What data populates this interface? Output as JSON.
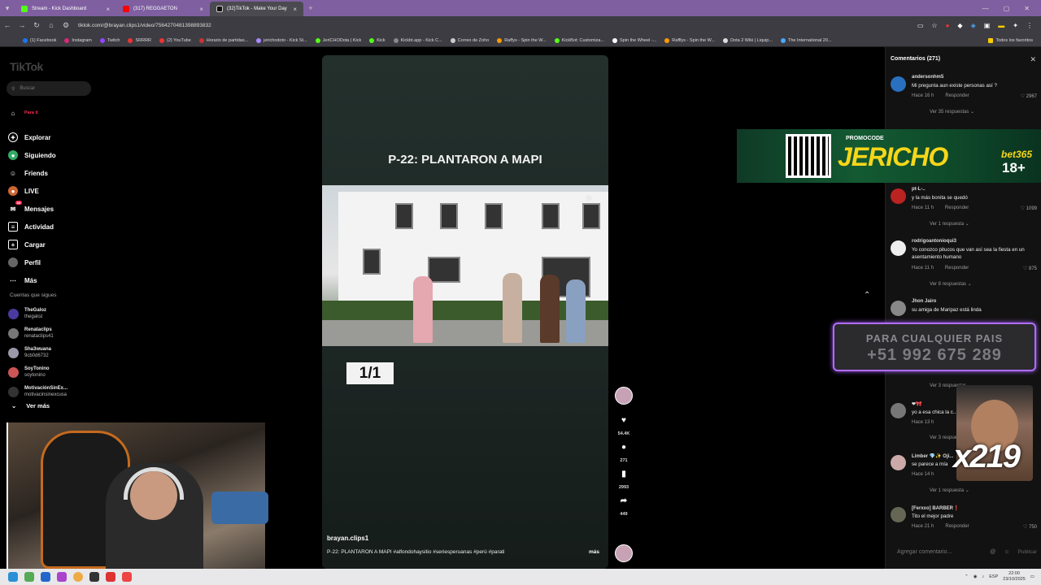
{
  "browser": {
    "tabs": [
      {
        "label": "Stream - Kick Dashboard",
        "color": "#53fc18"
      },
      {
        "label": "(317) REGGAETON",
        "color": "#ff0000"
      },
      {
        "label": "(32)TikTok - Make Your Day",
        "color": "#000000"
      }
    ],
    "url": "tiktok.com/@brayan.clips1/video/7564270481398893832",
    "bookmarks": [
      "(1) Facebook",
      "Instagram",
      "Twitch",
      "SRRRR",
      "(2) YouTube",
      "Horario de partidas...",
      "jerichodoto - Kick St...",
      "JeriCHODota | Kick",
      "Kick",
      "Kickbt.app - Kick C...",
      "Correo de Zoho",
      "Raffys - Spin the W...",
      "KickBot: Customiza...",
      "Spin the Wheel -...",
      "Rafflys - Spin the W...",
      "Dota 2 Wiki | Liquip...",
      "The International 20..."
    ],
    "bookmarks_all": "Todos los favoritos"
  },
  "sidebar": {
    "logo": "TikTok",
    "search_placeholder": "Buscar",
    "nav": [
      {
        "label": "Para ti",
        "icon": "home-icon"
      },
      {
        "label": "Explorar",
        "icon": "compass-icon"
      },
      {
        "label": "Siguiendo",
        "icon": "following-icon"
      },
      {
        "label": "Friends",
        "icon": "friends-icon"
      },
      {
        "label": "LIVE",
        "icon": "live-icon"
      },
      {
        "label": "Mensajes",
        "icon": "messages-icon",
        "badge": "34"
      },
      {
        "label": "Actividad",
        "icon": "activity-icon"
      },
      {
        "label": "Cargar",
        "icon": "upload-icon"
      },
      {
        "label": "Perfil",
        "icon": "profile-icon"
      },
      {
        "label": "Más",
        "icon": "more-icon"
      }
    ],
    "following_header": "Cuentas que sigues",
    "following": [
      {
        "name": "TheGaloz",
        "handle": "thegaloz"
      },
      {
        "name": "Renataclips",
        "handle": "renataclips41"
      },
      {
        "name": "Sha3wuana",
        "handle": "9cb0d6732"
      },
      {
        "name": "SoyTonino",
        "handle": "soytonino"
      },
      {
        "name": "MotivaciónSinEx...",
        "handle": "motivacinsinexcusa"
      }
    ],
    "see_more": "Ver más"
  },
  "video": {
    "title": "P-22: PLANTARON A MAPI",
    "fraction": "1/1",
    "username": "brayan.clips1",
    "description": "P-22: PLANTARON A MAPI #alfondohaysitio #seriesperuanas #perú #parati",
    "more": "más",
    "likes": "54.4K",
    "comments": "271",
    "saves": "2993",
    "shares": "449"
  },
  "comments": {
    "header": "Comentarios (271)",
    "items": [
      {
        "user": "andersonhm5",
        "text": "Mi pregunta aun existe personas así ?",
        "time": "Hace 16 h",
        "reply": "Responder",
        "likes": "2967",
        "replies": "Ver 35 respuestas"
      },
      {
        "user": "pt-L-..",
        "text": "y la más bonita se quedó",
        "time": "Hace 11 h",
        "reply": "Responder",
        "likes": "1099",
        "replies": "Ver 1 respuesta"
      },
      {
        "user": "rodrigoantonioqui3",
        "text": "Yo conozco pitucos que van así sea la fiesta en un asentamiento humano",
        "time": "Hace 11 h",
        "reply": "Responder",
        "likes": "875",
        "replies": "Ver 8 respuestas"
      },
      {
        "user": "Jhon Jairo",
        "text": "su amiga de Maripaz está linda",
        "time": "Hace 14 h",
        "reply": "Responder",
        "likes": "",
        "replies": "Ver 3 respuestas"
      },
      {
        "user": "❤🎀",
        "text": "yo a esa chica la c...",
        "time": "Hace 13 h",
        "reply": "Responder",
        "likes": "",
        "replies": "Ver 3 respuestas"
      },
      {
        "user": "Limber 💎✨ Oji...",
        "text": "se parece a mía",
        "time": "Hace 14 h",
        "reply": "Responder",
        "likes": "",
        "replies": "Ver 1 respuesta"
      },
      {
        "user": "[Ferxxo] BARBER❗",
        "text": "Tito el mejor padre",
        "time": "Hace 21 h",
        "reply": "Responder",
        "likes": "750",
        "replies": ""
      }
    ],
    "input_placeholder": "Agregar comentario...",
    "publish": "Publicar"
  },
  "overlays": {
    "ad_promo": "PROMOCODE",
    "ad_code": "JERICHO",
    "ad_brand": "bet365",
    "ad_age": "18+",
    "phone_label": "PARA CUALQUIER PAIS",
    "phone_number": "+51 992 675 289",
    "multiplier": "x219"
  },
  "taskbar": {
    "lang": "ESP",
    "time": "22:00",
    "date": "23/10/2025"
  }
}
